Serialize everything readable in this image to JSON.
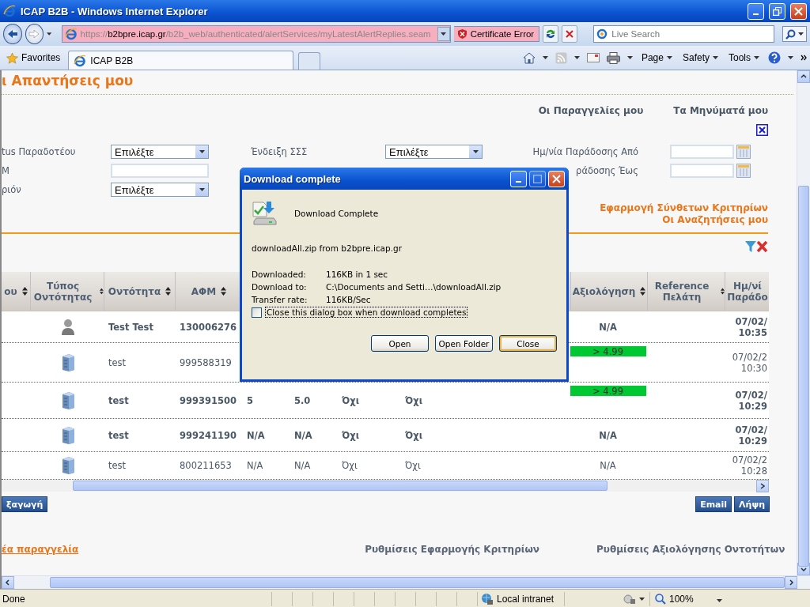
{
  "window": {
    "title": "ICAP B2B - Windows Internet Explorer"
  },
  "address_bar": {
    "url_scheme": "https://",
    "url_host": "b2bpre.icap.gr",
    "url_path": "/b2b_web/authenticated/alertServices/myLatestAlertReplies.seam",
    "certificate_error": "Certificate Error"
  },
  "search": {
    "placeholder": "Live Search"
  },
  "favorites": "Favorites",
  "tabs": [
    {
      "label": "ICAP B2B",
      "selected": true
    }
  ],
  "command_bar": [
    "Page",
    "Safety",
    "Tools"
  ],
  "page": {
    "heading": "ι Απαντήσεις μου",
    "top_links": [
      "Οι Παραγγελίες μου",
      "Τα Μηνύματά μου"
    ],
    "filter_columns": [
      [
        {
          "label": "tus Παραδοτέου",
          "kind": "select",
          "value": "Επιλέξτε"
        },
        {
          "label": "Μ",
          "kind": "text"
        },
        {
          "label": "ριόν",
          "kind": "select",
          "value": "Επιλέξτε"
        }
      ],
      [
        {
          "label": "Ένδειξη ΣΣΣ",
          "kind": "select",
          "value": "Επιλέξτε"
        }
      ],
      [
        {
          "label": "Ημ/νία Παράδοσης Από",
          "kind": "date"
        },
        {
          "label": "ράδοσης Έως",
          "kind": "date"
        }
      ]
    ],
    "criteria_links": [
      "Εφαρμογή Σύνθετων Κριτηρίων",
      "Οι Αναζητήσεις μου"
    ],
    "table": {
      "columns": [
        {
          "label": "ου",
          "sortable": true
        },
        {
          "label": "Τύπος Οντότητας",
          "sortable": true
        },
        {
          "label": "Οντότητα",
          "sortable": true
        },
        {
          "label": "ΑΦΜ",
          "sortable": true
        },
        {
          "label": "Αξιολόγηση",
          "sortable": true
        },
        {
          "label": "Reference Πελάτη",
          "sortable": true
        },
        {
          "label": "Ημ/νί Παράδο",
          "sortable": false
        }
      ],
      "rows": [
        {
          "bold": true,
          "kind": "person",
          "entity": "Test Test",
          "vat": "130006276",
          "rating": {
            "text": "N/A",
            "highlighted": false
          },
          "date": "07/02/",
          "time": "10:35"
        },
        {
          "bold": false,
          "kind": "company",
          "entity": "test",
          "vat": "999588319",
          "rating": {
            "text": "> 4.99",
            "highlighted": true
          },
          "date": "07/02/2",
          "time": "10:30"
        },
        {
          "bold": true,
          "kind": "company",
          "entity": "test",
          "vat": "999391500",
          "column_5": "5",
          "column_6": "5.0",
          "column_7": "Όχι",
          "column_8": "Όχι",
          "rating": {
            "text": "> 4.99",
            "highlighted": true
          },
          "date": "07/02/",
          "time": "10:29"
        },
        {
          "bold": true,
          "kind": "company",
          "entity": "test",
          "vat": "999241190",
          "column_5": "N/A",
          "column_6": "N/A",
          "column_7": "Όχι",
          "column_8": "Όχι",
          "rating": {
            "text": "N/A",
            "highlighted": false
          },
          "date": "07/02/",
          "time": "10:29"
        },
        {
          "bold": false,
          "kind": "company",
          "entity": "test",
          "vat": "800211653",
          "column_5": "N/A",
          "column_6": "N/A",
          "column_7": "Όχι",
          "column_8": "Όχι",
          "rating": {
            "text": "N/A",
            "highlighted": false
          },
          "date": "07/02/2",
          "time": "10:28"
        }
      ]
    },
    "actions_left": [
      "ξαγωγή"
    ],
    "actions_right": [
      "Email",
      "Λήψη"
    ],
    "footer_links": [
      {
        "text": "έα παραγγελία",
        "kind": "link"
      },
      {
        "text": "Ρυθμίσεις Εφαρμογής Κριτηρίων",
        "kind": "label"
      },
      {
        "text": "Ρυθμίσεις Αξιολόγησης Οντοτήτων",
        "kind": "label"
      }
    ]
  },
  "dialog": {
    "title": "Download complete",
    "status": "Download Complete",
    "source": "downloadAll.zip from b2bpre.icap.gr",
    "details": [
      {
        "label": "Downloaded:",
        "value": "116KB in 1 sec"
      },
      {
        "label": "Download to:",
        "value": "C:\\Documents and Setti…\\downloadAll.zip"
      },
      {
        "label": "Transfer rate:",
        "value": "116KB/Sec"
      }
    ],
    "close_when_done": {
      "label": "Close this dialog box when download completes",
      "checked": false
    },
    "buttons": [
      {
        "label": "Open",
        "default": false
      },
      {
        "label": "Open Folder",
        "default": false
      },
      {
        "label": "Close",
        "default": true
      }
    ]
  },
  "status_bar": {
    "status": "Done",
    "zone": "Local intranet",
    "zoom": "100%"
  }
}
